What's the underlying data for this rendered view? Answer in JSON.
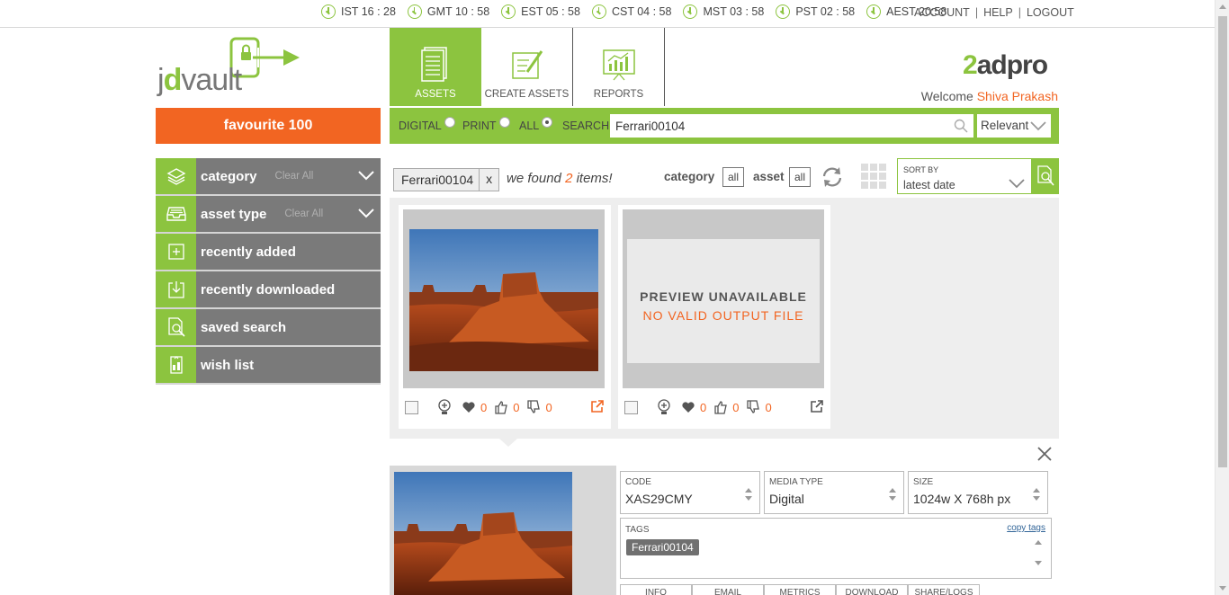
{
  "clocks": [
    "IST 16 : 28",
    "GMT 10 : 58",
    "EST 05 : 58",
    "CST 04 : 58",
    "MST 03 : 58",
    "PST 02 : 58",
    "AEST 20:58"
  ],
  "account": {
    "account": "ACCOUNT",
    "help": "HELP",
    "logout": "LOGOUT",
    "sep": "|"
  },
  "logo": {
    "prefix": "j",
    "mid": "d",
    "suffix": "vault"
  },
  "nav": [
    {
      "label": "ASSETS",
      "icon": "document-list-icon"
    },
    {
      "label": "CREATE ASSETS",
      "icon": "edit-document-icon"
    },
    {
      "label": "REPORTS",
      "icon": "chart-board-icon"
    }
  ],
  "brand": {
    "num": "2",
    "text": "adpro"
  },
  "welcome": {
    "prefix": "Welcome",
    "name": "Shiva Prakash"
  },
  "favourite": "favourite 100",
  "sidebar": [
    {
      "label": "category",
      "clear": "Clear All",
      "icon": "layers-icon"
    },
    {
      "label": "asset type",
      "clear": "Clear All",
      "icon": "tray-icon"
    },
    {
      "label": "recently added",
      "icon": "plus-box-icon"
    },
    {
      "label": "recently downloaded",
      "icon": "download-icon"
    },
    {
      "label": "saved search",
      "icon": "search-document-icon"
    },
    {
      "label": "wish list",
      "icon": "wishlist-icon"
    }
  ],
  "search": {
    "digital": "DIGITAL",
    "print": "PRINT",
    "all": "ALL",
    "search_label": "SEARCH",
    "value": "Ferrari00104",
    "relevance": "Relevant"
  },
  "results": {
    "chip": "Ferrari00104",
    "chip_close": "x",
    "found_prefix": "we found",
    "found_count": "2",
    "found_suffix": "items!",
    "category_label": "category",
    "asset_label": "asset",
    "all": "all",
    "sort_label": "SORT BY",
    "sort_value": "latest date"
  },
  "cards": [
    {
      "likes": "0",
      "ups": "0",
      "downs": "0",
      "preview": true
    },
    {
      "likes": "0",
      "ups": "0",
      "downs": "0",
      "preview": false,
      "unavailable": "PREVIEW UNAVAILABLE",
      "reason": "NO VALID OUTPUT FILE"
    }
  ],
  "detail": {
    "code_label": "CODE",
    "code": "XAS29CMY",
    "media_label": "MEDIA TYPE",
    "media": "Digital",
    "size_label": "SIZE",
    "size": "1024w X 768h px",
    "tags_label": "TAGS",
    "copy_tags": "copy tags",
    "tag": "Ferrari00104",
    "tabs": [
      "INFO",
      "EMAIL",
      "METRICS",
      "DOWNLOAD",
      "SHARE/LOGS"
    ]
  },
  "colors": {
    "accent": "#8cc43f",
    "orange": "#f26522",
    "sidebar": "#7a7a7a"
  }
}
